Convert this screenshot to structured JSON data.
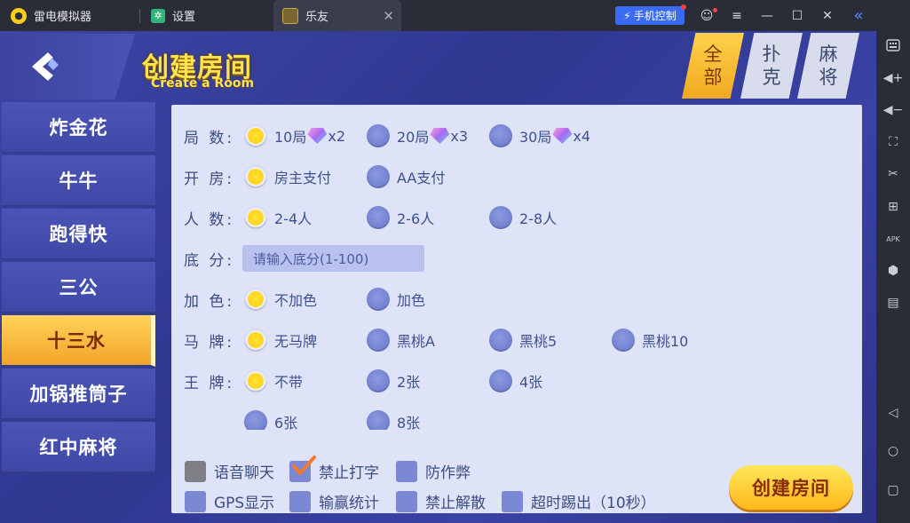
{
  "titlebar": {
    "app_name": "雷电模拟器",
    "tab_settings": "设置",
    "tab_game": "乐友",
    "tab_close": "✕",
    "phone_control": "手机控制",
    "win_buttons": [
      "☺",
      "≡",
      "—",
      "☐",
      "✕",
      "«"
    ]
  },
  "right_toolbar": {
    "icons": [
      "keyboard-icon",
      "volume-up-icon",
      "volume-down-icon",
      "screenshot-icon",
      "scissors-icon",
      "add-window-icon",
      "apk-icon",
      "gear-hex-icon",
      "more-icon",
      "back-icon",
      "home-icon",
      "recent-apps-icon"
    ],
    "apk_label": "APK"
  },
  "header": {
    "title_cn": "创建房间",
    "title_en": "Create a Room",
    "categories": [
      {
        "line1": "全",
        "line2": "部"
      },
      {
        "line1": "扑",
        "line2": "克"
      },
      {
        "line1": "麻",
        "line2": "将"
      }
    ]
  },
  "menu": {
    "items": [
      "炸金花",
      "牛牛",
      "跑得快",
      "三公",
      "十三水",
      "加锅推筒子",
      "红中麻将"
    ],
    "active_index": 4
  },
  "rules": {
    "rounds": {
      "label": "局 数:",
      "options": [
        {
          "text": "10局",
          "mult": "x2"
        },
        {
          "text": "20局",
          "mult": "x3"
        },
        {
          "text": "30局",
          "mult": "x4"
        }
      ],
      "selected": 0
    },
    "payment": {
      "label": "开 房:",
      "options": [
        "房主支付",
        "AA支付"
      ],
      "selected": 0
    },
    "players": {
      "label": "人 数:",
      "options": [
        "2-4人",
        "2-6人",
        "2-8人"
      ],
      "selected": 0
    },
    "base_score": {
      "label": "底 分:",
      "placeholder": "请输入底分(1-100)"
    },
    "add_color": {
      "label": "加 色:",
      "options": [
        "不加色",
        "加色"
      ],
      "selected": 0
    },
    "horse_card": {
      "label": "马 牌:",
      "options": [
        "无马牌",
        "黑桃A",
        "黑桃5",
        "黑桃10"
      ],
      "selected": 0
    },
    "king_card": {
      "label": "王 牌:",
      "options": [
        "不带",
        "2张",
        "4张",
        "6张",
        "8张"
      ],
      "selected": 0
    }
  },
  "settings": {
    "checks": [
      {
        "label": "语音聊天",
        "checked": false
      },
      {
        "label": "禁止打字",
        "checked": true
      },
      {
        "label": "防作弊",
        "checked": false
      },
      {
        "label": "GPS显示",
        "checked": false
      },
      {
        "label": "输赢统计",
        "checked": false
      },
      {
        "label": "禁止解散",
        "checked": false
      },
      {
        "label": "超时踢出（10秒）",
        "checked": false
      }
    ]
  },
  "create_button": "创建房间",
  "colors": {
    "accent_yellow": "#ffd41a",
    "panel_bg": "#dfe3f8",
    "brand_blue": "#3d45a8",
    "phone_ctrl_blue": "#3b6bf5"
  }
}
